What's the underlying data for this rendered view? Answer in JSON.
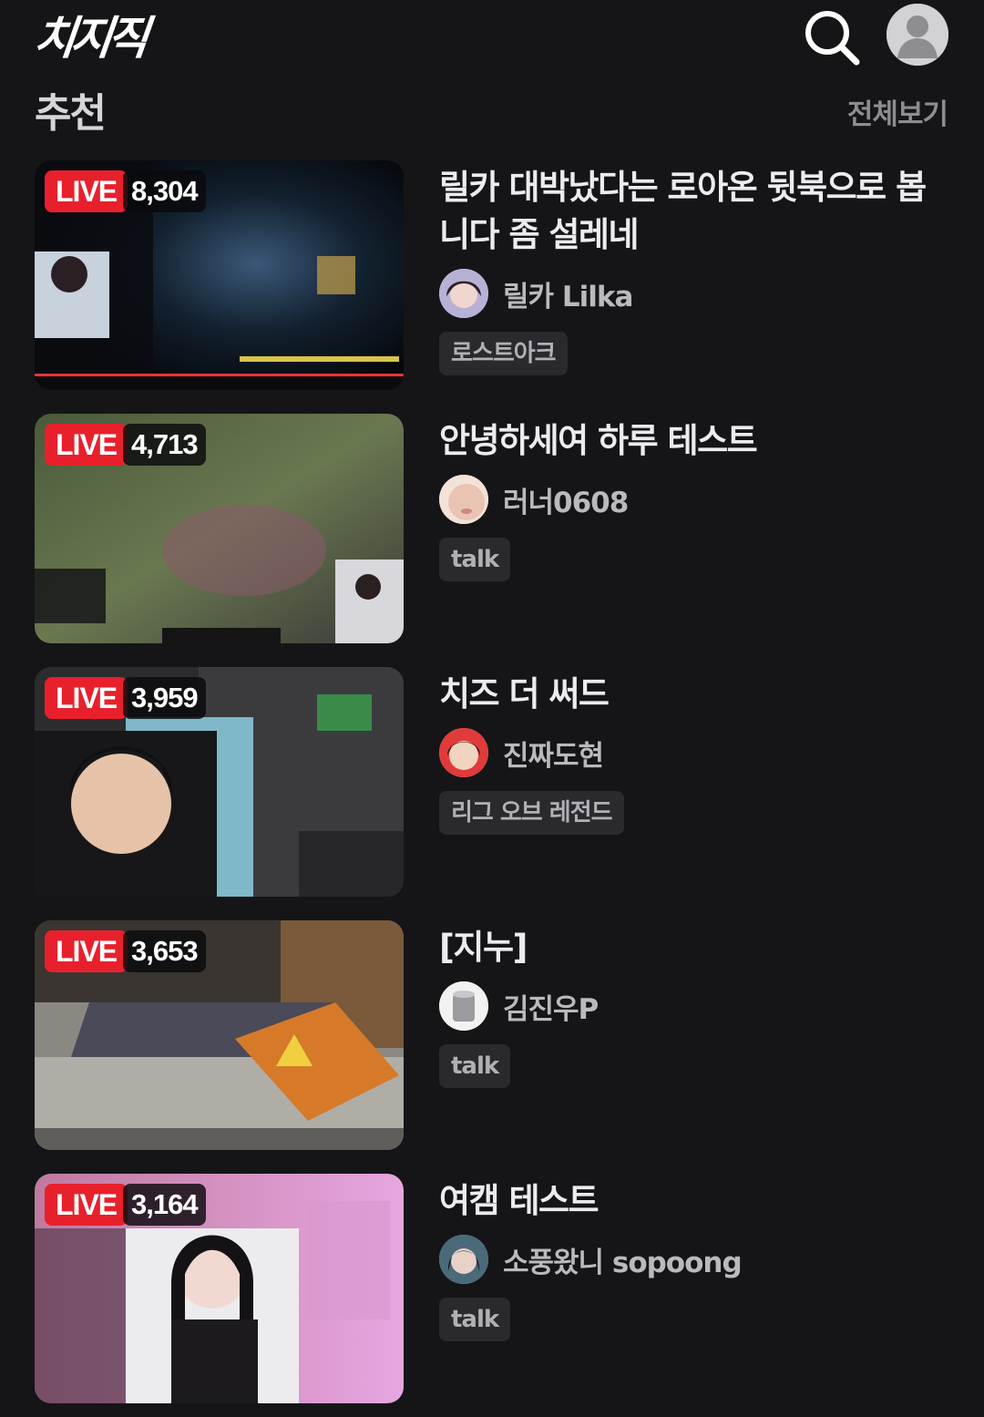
{
  "app": {
    "logo_text": "치지직",
    "search_icon": "search-icon",
    "profile_icon": "user-avatar-icon"
  },
  "section": {
    "title": "추천",
    "view_all_label": "전체보기"
  },
  "streams": [
    {
      "live_label": "LIVE",
      "viewers": "8,304",
      "title": "릴카 대박났다는 로아온 뒷북으로 봅니다 좀 설레네",
      "channel": "릴카 Lilka",
      "category": "로스트아크"
    },
    {
      "live_label": "LIVE",
      "viewers": "4,713",
      "title": "안녕하세여 하루 테스트",
      "channel": "러너0608",
      "category": "talk"
    },
    {
      "live_label": "LIVE",
      "viewers": "3,959",
      "title": "치즈 더 써드",
      "channel": "진짜도현",
      "category": "리그 오브 레전드"
    },
    {
      "live_label": "LIVE",
      "viewers": "3,653",
      "title": "[지누]",
      "channel": "김진우P",
      "category": "talk"
    },
    {
      "live_label": "LIVE",
      "viewers": "3,164",
      "title": "여캠 테스트",
      "channel": "소풍왔니 sopoong",
      "category": "talk"
    }
  ],
  "colors": {
    "background": "#151517",
    "live_red": "#e8202c",
    "tag_bg": "#2a2a2e",
    "muted_text": "#8c8c92"
  }
}
